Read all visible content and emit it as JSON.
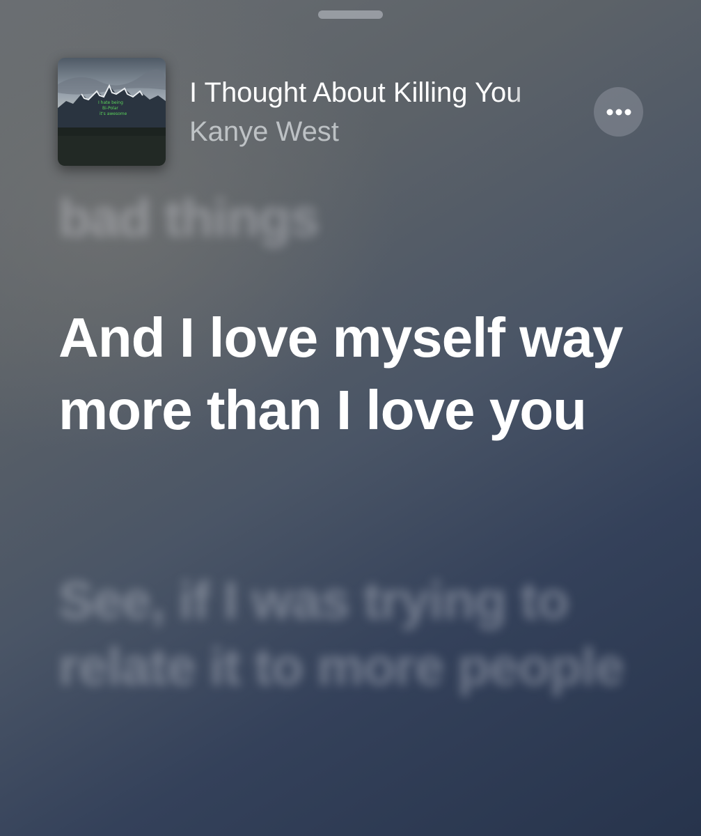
{
  "now_playing": {
    "title": "I Thought About Killing You",
    "artist": "Kanye West",
    "more_button_icon": "ellipsis-icon"
  },
  "lyrics": {
    "previous": "bad things",
    "current": "And I love myself way more than I love you",
    "next": "See, if I was trying to relate it to more people"
  },
  "album_art": {
    "cover_text": [
      "I hate being",
      "Bi-Polar",
      "it's awesome"
    ],
    "cover_text_color": "#5bd35a"
  }
}
